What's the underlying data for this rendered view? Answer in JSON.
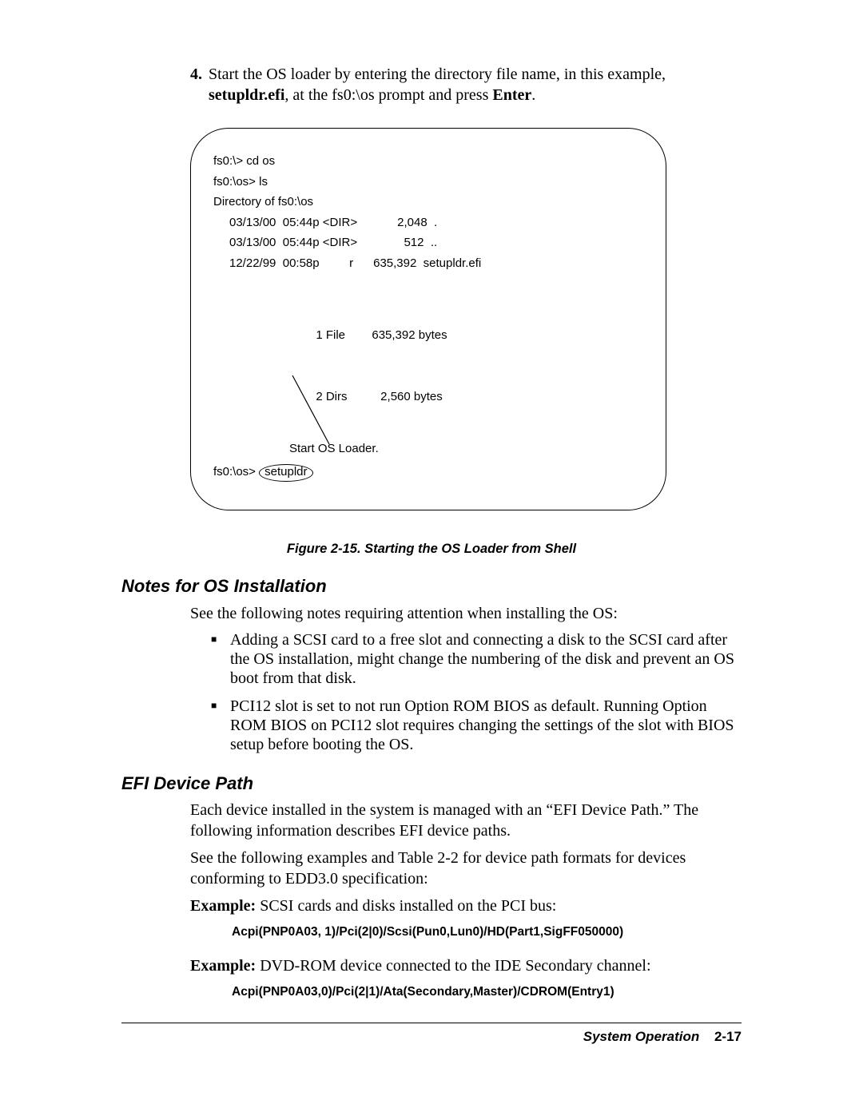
{
  "step": {
    "num": "4.",
    "text_pre": "Start the OS loader by entering the directory file name, in this example, ",
    "bold1": "setupldr.efi",
    "text_mid": ", at the fs0:\\os prompt and press ",
    "bold2": "Enter",
    "text_end": "."
  },
  "terminal": {
    "l1": "fs0:\\> cd os",
    "l2": "fs0:\\os> ls",
    "l3": "Directory of fs0:\\os",
    "r1": "03/13/00  05:44p <DIR>            2,048  .",
    "r2": "03/13/00  05:44p <DIR>              512  ..",
    "r3": "12/22/99  00:58p         r      635,392  setupldr.efi",
    "s1": "  1 File        635,392 bytes",
    "s2": "  2 Dirs          2,560 bytes",
    "cmd_prefix": "fs0:\\os>",
    "cmd_oval": "setupldr",
    "callout": "Start OS Loader."
  },
  "figure_caption": "Figure 2-15.  Starting the OS Loader from Shell",
  "section_notes_heading": "Notes for OS Installation",
  "notes_intro": "See the following notes requiring attention when installing the OS:",
  "notes_bullets": [
    "Adding a SCSI card to a free slot and connecting a disk to the SCSI card after the OS installation, might change the numbering of the disk and prevent an OS boot from that disk.",
    "PCI12 slot is set to not run Option ROM BIOS as default. Running Option ROM BIOS on PCI12 slot requires changing the settings of the slot with BIOS setup before booting the OS."
  ],
  "section_efi_heading": "EFI Device Path",
  "efi_p1": "Each device installed in the system is managed with an “EFI Device Path.” The following information describes EFI device paths.",
  "efi_p2": "See the following examples and Table 2-2 for device path formats for devices conforming to EDD3.0 specification:",
  "example1_label": "Example:",
  "example1_text": "  SCSI cards and disks installed on the PCI bus:",
  "example1_code": "Acpi(PNP0A03, 1)/Pci(2|0)/Scsi(Pun0,Lun0)/HD(Part1,SigFF050000)",
  "example2_label": "Example:",
  "example2_text": "  DVD-ROM device connected to the IDE Secondary channel:",
  "example2_code": "Acpi(PNP0A03,0)/Pci(2|1)/Ata(Secondary,Master)/CDROM(Entry1)",
  "footer_title": "System Operation",
  "footer_page": "2-17"
}
